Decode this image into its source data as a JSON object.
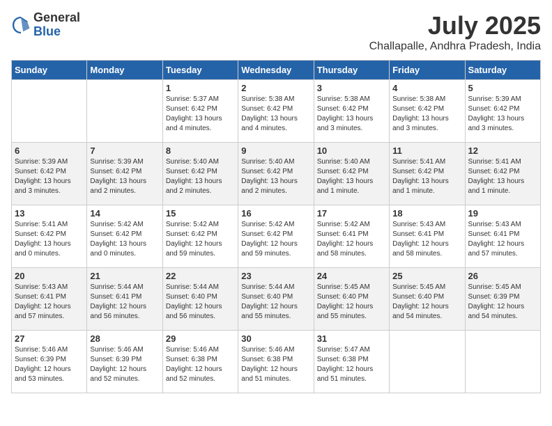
{
  "logo": {
    "general": "General",
    "blue": "Blue"
  },
  "header": {
    "month": "July 2025",
    "location": "Challapalle, Andhra Pradesh, India"
  },
  "weekdays": [
    "Sunday",
    "Monday",
    "Tuesday",
    "Wednesday",
    "Thursday",
    "Friday",
    "Saturday"
  ],
  "weeks": [
    [
      {
        "day": "",
        "info": ""
      },
      {
        "day": "",
        "info": ""
      },
      {
        "day": "1",
        "info": "Sunrise: 5:37 AM\nSunset: 6:42 PM\nDaylight: 13 hours and 4 minutes."
      },
      {
        "day": "2",
        "info": "Sunrise: 5:38 AM\nSunset: 6:42 PM\nDaylight: 13 hours and 4 minutes."
      },
      {
        "day": "3",
        "info": "Sunrise: 5:38 AM\nSunset: 6:42 PM\nDaylight: 13 hours and 3 minutes."
      },
      {
        "day": "4",
        "info": "Sunrise: 5:38 AM\nSunset: 6:42 PM\nDaylight: 13 hours and 3 minutes."
      },
      {
        "day": "5",
        "info": "Sunrise: 5:39 AM\nSunset: 6:42 PM\nDaylight: 13 hours and 3 minutes."
      }
    ],
    [
      {
        "day": "6",
        "info": "Sunrise: 5:39 AM\nSunset: 6:42 PM\nDaylight: 13 hours and 3 minutes."
      },
      {
        "day": "7",
        "info": "Sunrise: 5:39 AM\nSunset: 6:42 PM\nDaylight: 13 hours and 2 minutes."
      },
      {
        "day": "8",
        "info": "Sunrise: 5:40 AM\nSunset: 6:42 PM\nDaylight: 13 hours and 2 minutes."
      },
      {
        "day": "9",
        "info": "Sunrise: 5:40 AM\nSunset: 6:42 PM\nDaylight: 13 hours and 2 minutes."
      },
      {
        "day": "10",
        "info": "Sunrise: 5:40 AM\nSunset: 6:42 PM\nDaylight: 13 hours and 1 minute."
      },
      {
        "day": "11",
        "info": "Sunrise: 5:41 AM\nSunset: 6:42 PM\nDaylight: 13 hours and 1 minute."
      },
      {
        "day": "12",
        "info": "Sunrise: 5:41 AM\nSunset: 6:42 PM\nDaylight: 13 hours and 1 minute."
      }
    ],
    [
      {
        "day": "13",
        "info": "Sunrise: 5:41 AM\nSunset: 6:42 PM\nDaylight: 13 hours and 0 minutes."
      },
      {
        "day": "14",
        "info": "Sunrise: 5:42 AM\nSunset: 6:42 PM\nDaylight: 13 hours and 0 minutes."
      },
      {
        "day": "15",
        "info": "Sunrise: 5:42 AM\nSunset: 6:42 PM\nDaylight: 12 hours and 59 minutes."
      },
      {
        "day": "16",
        "info": "Sunrise: 5:42 AM\nSunset: 6:42 PM\nDaylight: 12 hours and 59 minutes."
      },
      {
        "day": "17",
        "info": "Sunrise: 5:42 AM\nSunset: 6:41 PM\nDaylight: 12 hours and 58 minutes."
      },
      {
        "day": "18",
        "info": "Sunrise: 5:43 AM\nSunset: 6:41 PM\nDaylight: 12 hours and 58 minutes."
      },
      {
        "day": "19",
        "info": "Sunrise: 5:43 AM\nSunset: 6:41 PM\nDaylight: 12 hours and 57 minutes."
      }
    ],
    [
      {
        "day": "20",
        "info": "Sunrise: 5:43 AM\nSunset: 6:41 PM\nDaylight: 12 hours and 57 minutes."
      },
      {
        "day": "21",
        "info": "Sunrise: 5:44 AM\nSunset: 6:41 PM\nDaylight: 12 hours and 56 minutes."
      },
      {
        "day": "22",
        "info": "Sunrise: 5:44 AM\nSunset: 6:40 PM\nDaylight: 12 hours and 56 minutes."
      },
      {
        "day": "23",
        "info": "Sunrise: 5:44 AM\nSunset: 6:40 PM\nDaylight: 12 hours and 55 minutes."
      },
      {
        "day": "24",
        "info": "Sunrise: 5:45 AM\nSunset: 6:40 PM\nDaylight: 12 hours and 55 minutes."
      },
      {
        "day": "25",
        "info": "Sunrise: 5:45 AM\nSunset: 6:40 PM\nDaylight: 12 hours and 54 minutes."
      },
      {
        "day": "26",
        "info": "Sunrise: 5:45 AM\nSunset: 6:39 PM\nDaylight: 12 hours and 54 minutes."
      }
    ],
    [
      {
        "day": "27",
        "info": "Sunrise: 5:46 AM\nSunset: 6:39 PM\nDaylight: 12 hours and 53 minutes."
      },
      {
        "day": "28",
        "info": "Sunrise: 5:46 AM\nSunset: 6:39 PM\nDaylight: 12 hours and 52 minutes."
      },
      {
        "day": "29",
        "info": "Sunrise: 5:46 AM\nSunset: 6:38 PM\nDaylight: 12 hours and 52 minutes."
      },
      {
        "day": "30",
        "info": "Sunrise: 5:46 AM\nSunset: 6:38 PM\nDaylight: 12 hours and 51 minutes."
      },
      {
        "day": "31",
        "info": "Sunrise: 5:47 AM\nSunset: 6:38 PM\nDaylight: 12 hours and 51 minutes."
      },
      {
        "day": "",
        "info": ""
      },
      {
        "day": "",
        "info": ""
      }
    ]
  ]
}
